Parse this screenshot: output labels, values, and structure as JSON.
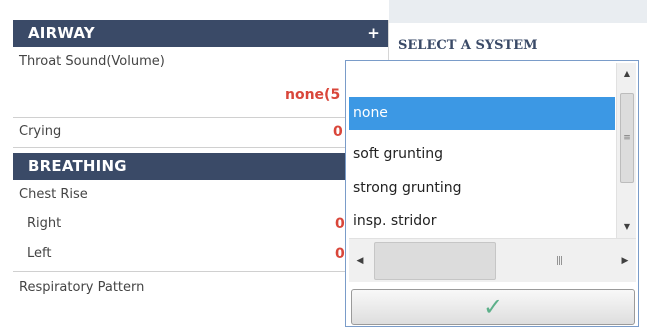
{
  "airway": {
    "title": "AIRWAY",
    "add_icon": "+",
    "throat_sound_label": "Throat Sound(Volume)",
    "throat_sound_value": "none(5",
    "crying_label": "Crying",
    "crying_value": "0"
  },
  "breathing": {
    "title": "BREATHING",
    "chest_rise_label": "Chest Rise",
    "right_label": "Right",
    "right_value": "0",
    "left_label": "Left",
    "left_value": "0",
    "respiratory_pattern_label": "Respiratory Pattern"
  },
  "system_select": {
    "title": "SELECT A SYSTEM"
  },
  "dropdown": {
    "options": [
      "none",
      "soft grunting",
      "strong grunting",
      "insp. stridor"
    ],
    "selected": "none",
    "confirm_icon": "check-icon"
  },
  "colors": {
    "header_bg": "#3a4a67",
    "value_red": "#d9463a",
    "selection_blue": "#3c98e4",
    "check_green": "#5db08a"
  }
}
